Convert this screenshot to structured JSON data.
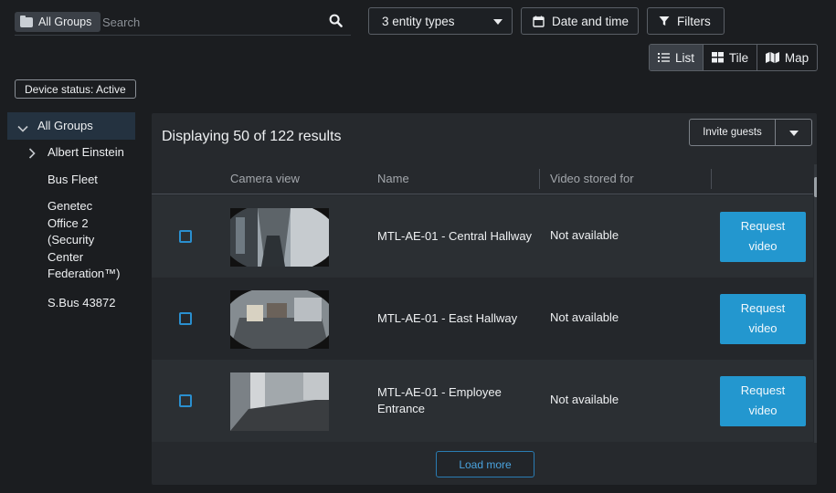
{
  "search": {
    "group_chip": "All Groups",
    "placeholder": "Search",
    "value": ""
  },
  "toolbar": {
    "entity_types": "3 entity types",
    "date_time": "Date and time",
    "filters": "Filters"
  },
  "view_toggle": {
    "list": "List",
    "tile": "Tile",
    "map": "Map",
    "selected": "List"
  },
  "status_chip": "Device status: Active",
  "tree": {
    "root": "All Groups",
    "items": [
      "Albert Einstein",
      "Bus Fleet",
      "Genetec Office 2 (Security Center Federation™)",
      "S.Bus 43872"
    ]
  },
  "results": {
    "title": "Displaying 50 of 122 results",
    "invite": "Invite guests",
    "columns": [
      "Camera view",
      "Name",
      "Video stored for"
    ],
    "rows": [
      {
        "name": "MTL-AE-01 - Central Hallway",
        "stored": "Not available",
        "action": "Request video"
      },
      {
        "name": "MTL-AE-01 - East Hallway",
        "stored": "Not available",
        "action": "Request video"
      },
      {
        "name": "MTL-AE-01 - Employee Entrance",
        "stored": "Not available",
        "action": "Request video"
      }
    ],
    "load_more": "Load more"
  },
  "colors": {
    "background": "#1b1d20",
    "panel": "#26292d",
    "accent": "#2397cf",
    "tree_selected": "#243240"
  }
}
